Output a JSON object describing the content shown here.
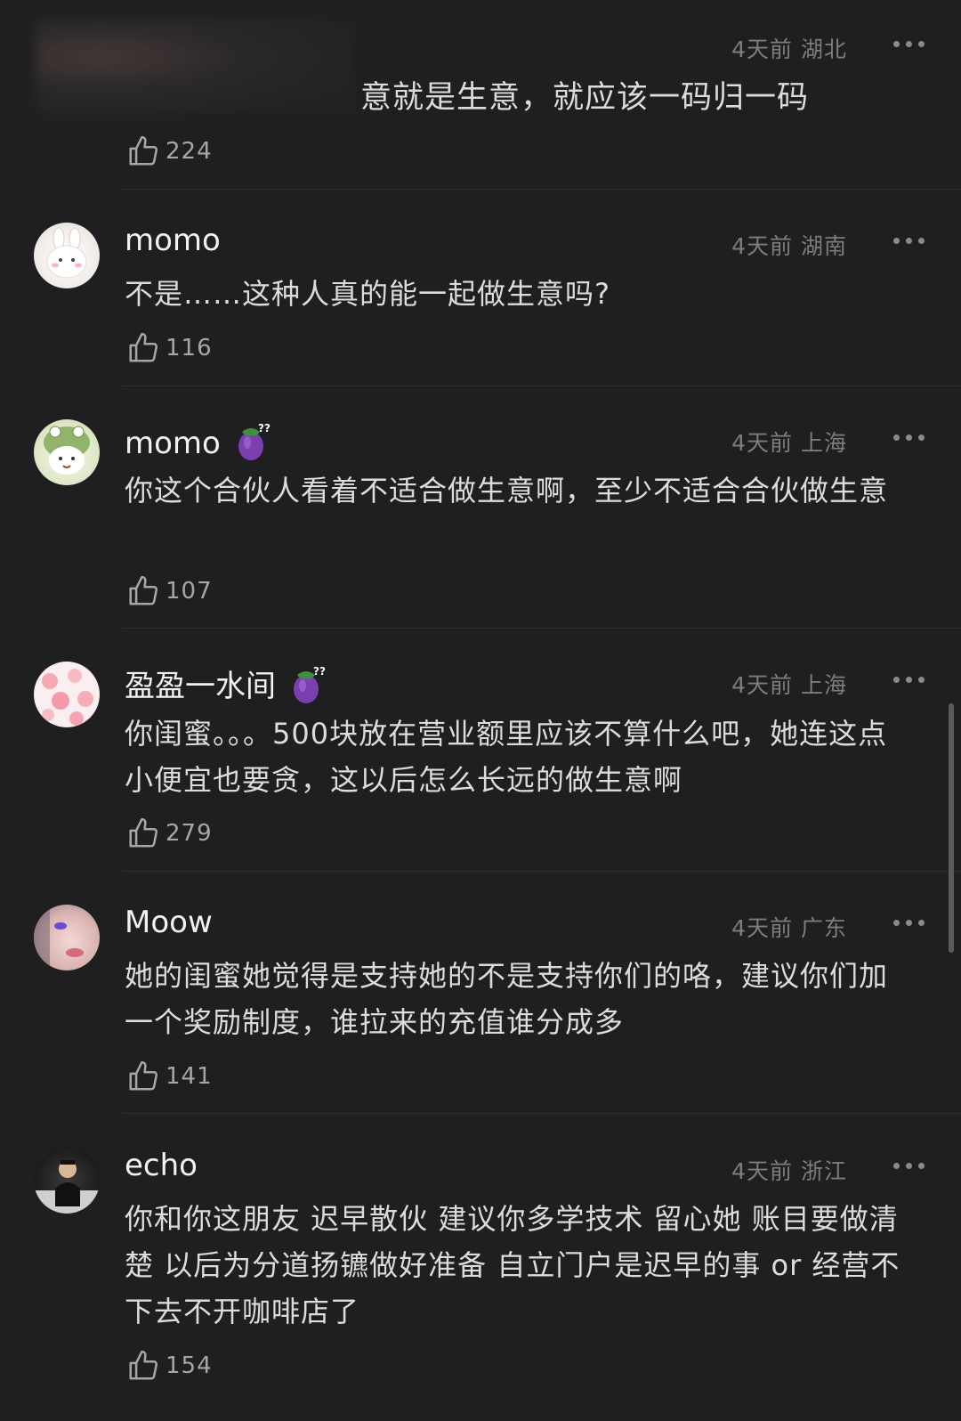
{
  "comments": [
    {
      "username": "",
      "time": "4天前",
      "location": "湖北",
      "text": "意就是生意，就应该一码归一码",
      "likes": "224"
    },
    {
      "username": "momo",
      "time": "4天前",
      "location": "湖南",
      "text": "不是……这种人真的能一起做生意吗?",
      "likes": "116"
    },
    {
      "username": "momo",
      "time": "4天前",
      "location": "上海",
      "text": "你这个合伙人看着不适合做生意啊，至少不适合合伙做生意",
      "likes": "107",
      "badge_icon": "eggplant-badge-icon"
    },
    {
      "username": "盈盈一水间",
      "time": "4天前",
      "location": "上海",
      "text": "你闺蜜。。。500块放在营业额里应该不算什么吧，她连这点小便宜也要贪，这以后怎么长远的做生意啊",
      "likes": "279",
      "badge_icon": "eggplant-badge-icon"
    },
    {
      "username": "Moow",
      "time": "4天前",
      "location": "广东",
      "text": "她的闺蜜她觉得是支持她的不是支持你们的咯，建议你们加一个奖励制度，谁拉来的充值谁分成多",
      "likes": "141"
    },
    {
      "username": "echo",
      "time": "4天前",
      "location": "浙江",
      "text": "你和你这朋友 迟早散伙 建议你多学技术 留心她 账目要做清楚 以后为分道扬镳做好准备  自立门户是迟早的事 or 经营不下去不开咖啡店了",
      "likes": "154"
    }
  ],
  "colors": {
    "background": "#1f1f21",
    "text": "#dcdcdc",
    "meta": "#7d7d80",
    "divider": "#2f2f32"
  }
}
